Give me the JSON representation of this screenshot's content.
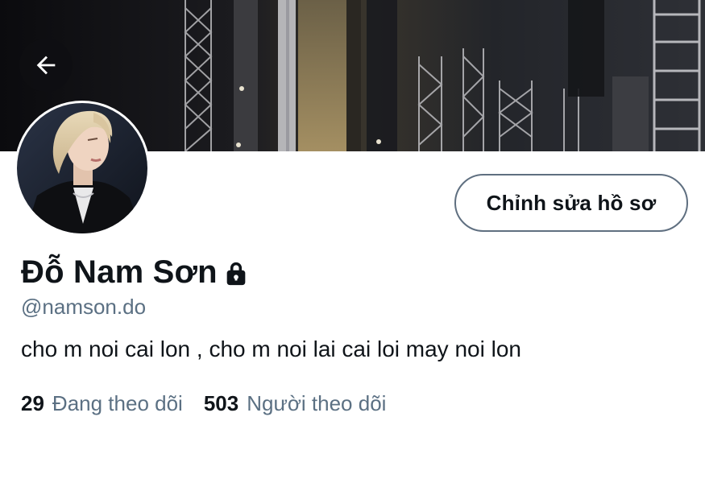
{
  "profile": {
    "display_name": "Đỗ Nam Sơn",
    "handle": "@namson.do",
    "bio": "cho m noi cai lon , cho m noi lai cai loi may noi lon",
    "protected": true
  },
  "actions": {
    "edit_profile_label": "Chỉnh sửa hồ sơ"
  },
  "stats": {
    "following_count": "29",
    "following_label": "Đang theo dõi",
    "followers_count": "503",
    "followers_label": "Người theo dõi"
  },
  "icons": {
    "back": "arrow-left-icon",
    "lock": "lock-icon"
  },
  "colors": {
    "text_primary": "#0f1419",
    "text_secondary": "#5b7083",
    "button_border": "#5f6f80"
  }
}
